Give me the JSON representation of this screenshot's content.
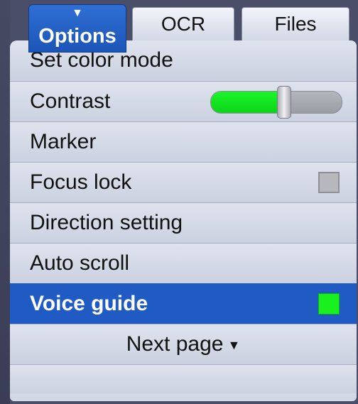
{
  "tabs": [
    {
      "label": "Options",
      "active": true
    },
    {
      "label": "OCR",
      "active": false
    },
    {
      "label": "Files",
      "active": false
    }
  ],
  "menu": {
    "items": [
      {
        "label": "Set color mode"
      },
      {
        "label": "Contrast",
        "control": "slider",
        "value_fraction": 0.56
      },
      {
        "label": "Marker"
      },
      {
        "label": "Focus lock",
        "control": "checkbox",
        "checked": false
      },
      {
        "label": "Direction setting"
      },
      {
        "label": "Auto scroll"
      },
      {
        "label": "Voice guide",
        "control": "indicator",
        "on": true,
        "selected": true
      }
    ],
    "next_page_label": "Next page",
    "next_page_icon": "triangle-down-icon"
  },
  "colors": {
    "accent": "#1f5bc2",
    "slider_fill": "#19f11f",
    "indicator_on": "#19f11f"
  }
}
